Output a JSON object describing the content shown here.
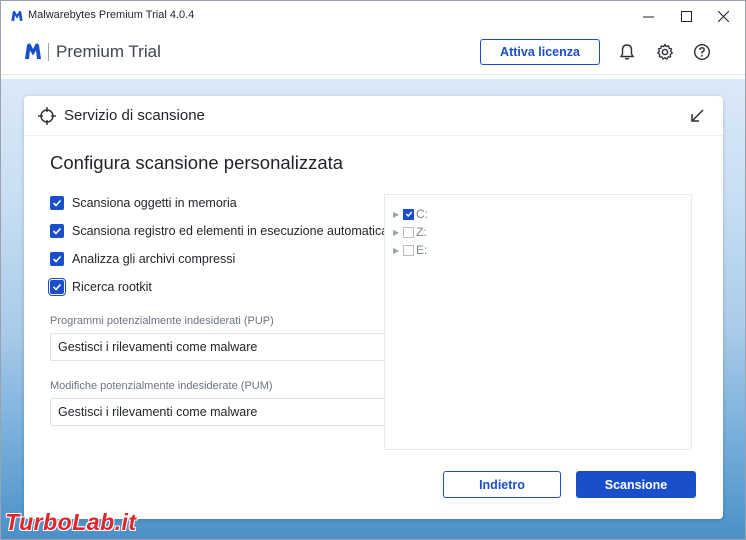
{
  "window": {
    "title": "Malwarebytes Premium Trial  4.0.4",
    "controls": {
      "minimize": "—",
      "maximize": "☐",
      "close": "✕"
    }
  },
  "header": {
    "brand_name": "Premium Trial",
    "license_button": "Attiva licenza",
    "icons": [
      "bell-icon",
      "gear-icon",
      "help-icon"
    ]
  },
  "panel": {
    "title": "Servizio di scansione",
    "section_title": "Configura scansione personalizzata",
    "options": [
      {
        "label": "Scansiona oggetti in memoria",
        "checked": true
      },
      {
        "label": "Scansiona registro ed elementi in esecuzione automatica",
        "checked": true
      },
      {
        "label": "Analizza gli archivi compressi",
        "checked": true
      },
      {
        "label": "Ricerca rootkit",
        "checked": true
      }
    ],
    "pup": {
      "label": "Programmi potenzialmente indesiderati (PUP)",
      "value": "Gestisci i rilevamenti come malware"
    },
    "pum": {
      "label": "Modifiche potenzialmente indesiderate (PUM)",
      "value": "Gestisci i rilevamenti come malware"
    },
    "drives": [
      {
        "label": "C:",
        "checked": true
      },
      {
        "label": "Z:",
        "checked": false
      },
      {
        "label": "E:",
        "checked": false
      }
    ],
    "back_button": "Indietro",
    "scan_button": "Scansione"
  },
  "watermark": "TurboLab.it",
  "colors": {
    "accent": "#1a4fcc",
    "watermark": "#e0262b"
  }
}
